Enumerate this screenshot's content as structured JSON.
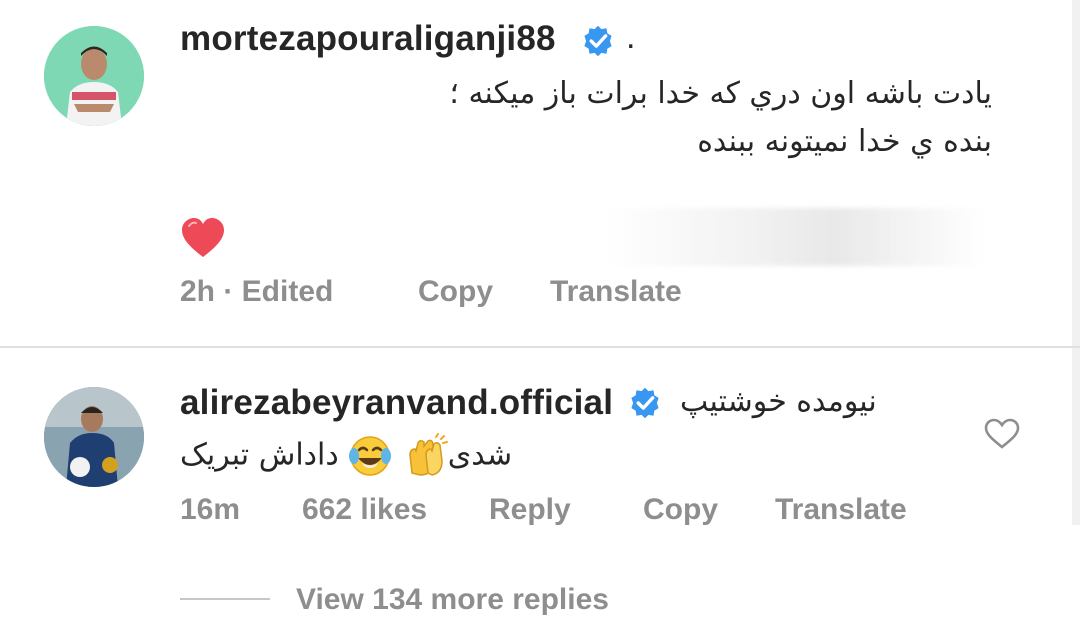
{
  "comments": [
    {
      "username": "mortezapouraliganji88",
      "verified": true,
      "after_name": ".",
      "text_lines": [
        "یادت باشه اون دري که خدا برات باز میکنه ؛",
        "بنده ي خدا نمیتونه ببنده"
      ],
      "liked": true,
      "meta": {
        "time": "2h · Edited",
        "copy": "Copy",
        "translate": "Translate"
      }
    },
    {
      "username": "alirezabeyranvand.official",
      "verified": true,
      "inline_text": "نیومده خوشتیپ",
      "second_line": "شدی",
      "second_line_tail": "داداش تبریک",
      "emojis": [
        "clapping-hands",
        "tears-of-joy"
      ],
      "liked": false,
      "meta": {
        "time": "16m",
        "likes": "662 likes",
        "reply": "Reply",
        "copy": "Copy",
        "translate": "Translate"
      }
    }
  ],
  "view_replies": "View 134 more replies",
  "colors": {
    "verified": "#3897f0",
    "heart": "#ed4956",
    "meta": "#8e8e8e",
    "text": "#262626"
  }
}
